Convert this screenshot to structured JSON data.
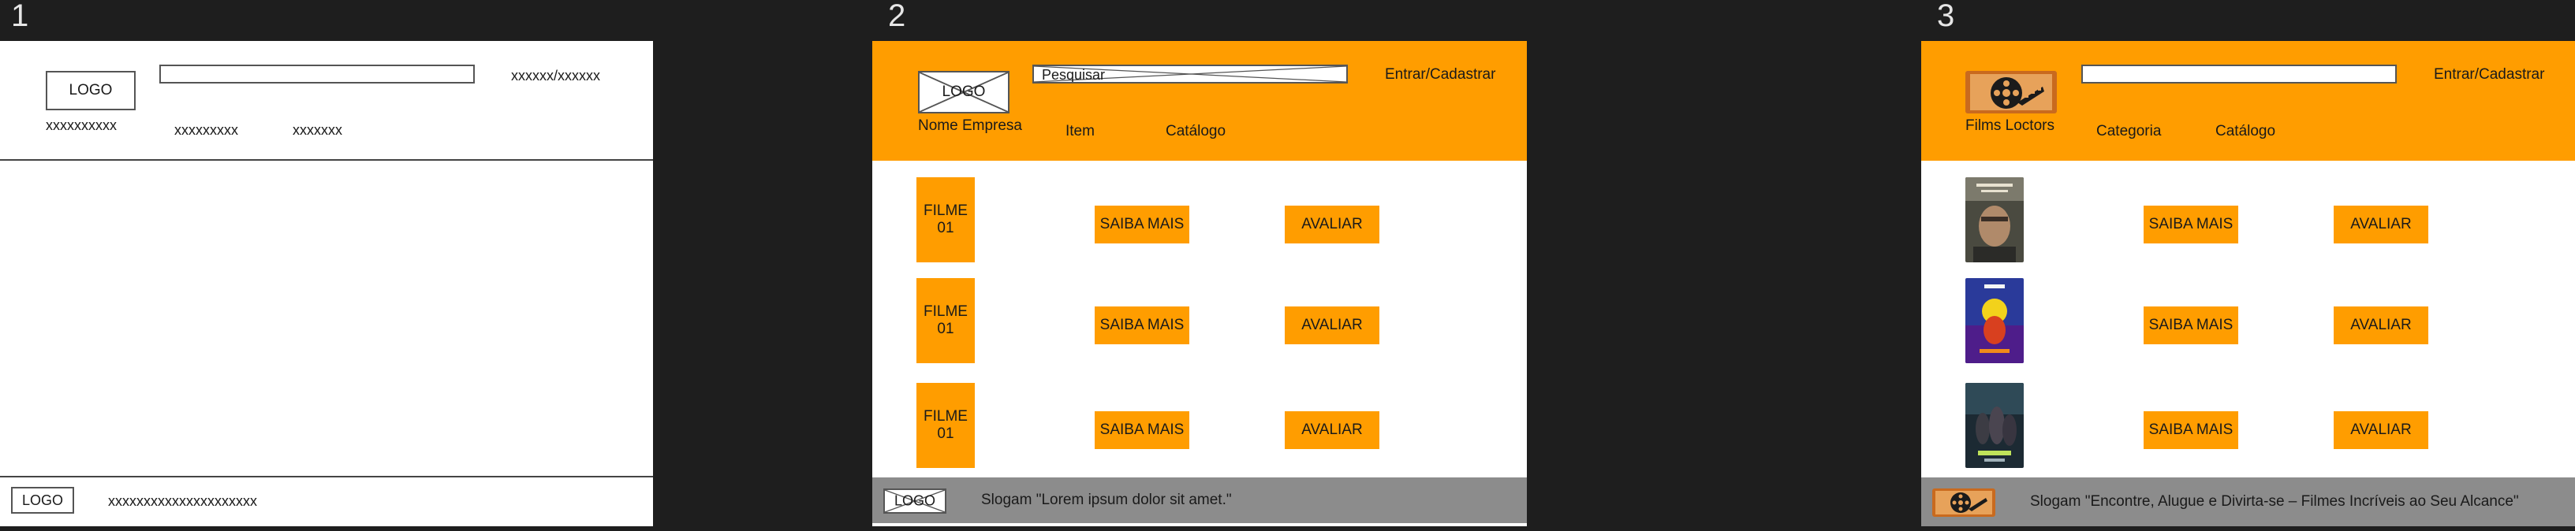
{
  "frame_numbers": [
    "1",
    "2",
    "3"
  ],
  "wireframe1": {
    "logo": "LOGO",
    "company": "xxxxxxxxxx",
    "nav": [
      "xxxxxxxxx",
      "xxxxxxx"
    ],
    "auth": "xxxxxx/xxxxxx",
    "search_value": "",
    "footer_logo": "LOGO",
    "footer_text": "xxxxxxxxxxxxxxxxxxxxx"
  },
  "wireframe2": {
    "logo": "LOGO",
    "company": "Nome Empresa",
    "search_placeholder": "Pesquisar",
    "auth": "Entrar/Cadastrar",
    "nav": [
      "Item",
      "Catálogo"
    ],
    "rows": [
      {
        "poster": "FILME\n01",
        "more": "SAIBA MAIS",
        "rate": "AVALIAR"
      },
      {
        "poster": "FILME\n01",
        "more": "SAIBA MAIS",
        "rate": "AVALIAR"
      },
      {
        "poster": "FILME\n01",
        "more": "SAIBA MAIS",
        "rate": "AVALIAR"
      }
    ],
    "footer_logo": "LOGO",
    "footer_text": "Slogam  \"Lorem ipsum dolor sit amet.\""
  },
  "mockup3": {
    "company": "Films Loctors",
    "search_value": "",
    "auth": "Entrar/Cadastrar",
    "nav": [
      "Categoria",
      "Catálogo"
    ],
    "rows": [
      {
        "more": "SAIBA MAIS",
        "rate": "AVALIAR"
      },
      {
        "more": "SAIBA MAIS",
        "rate": "AVALIAR"
      },
      {
        "more": "SAIBA MAIS",
        "rate": "AVALIAR"
      }
    ],
    "footer_text": "Slogam  \"Encontre, Alugue e Divirta-se – Filmes Incríveis ao Seu Alcance\""
  },
  "colors": {
    "accent": "#ff9d00",
    "footer_grey": "#8c8c8c",
    "canvas": "#1e1e1e",
    "page": "#ffffff"
  },
  "icons": [
    "film-reel-logo",
    "placeholder-x-image"
  ]
}
